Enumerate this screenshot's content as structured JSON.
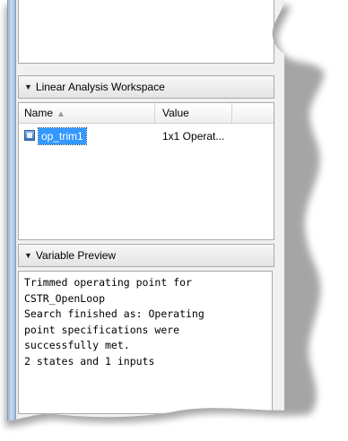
{
  "workspace": {
    "title": "Linear Analysis Workspace",
    "columns": {
      "name": "Name",
      "value": "Value"
    },
    "rows": [
      {
        "name": "op_trim1",
        "value": "1x1 Operat..."
      }
    ]
  },
  "preview": {
    "title": "Variable Preview",
    "lines": [
      "Trimmed operating point for",
      "CSTR_OpenLoop",
      "Search finished as: Operating",
      "point specifications were",
      "successfully met.",
      "2 states and 1 inputs"
    ]
  },
  "colors": {
    "selection": "#3399ff",
    "frame": "#9db8d6",
    "border": "#a9a9a9"
  },
  "icons": {
    "collapse": "triangle-down-icon",
    "sort": "sort-ascending-icon",
    "variable": "operating-point-icon"
  }
}
